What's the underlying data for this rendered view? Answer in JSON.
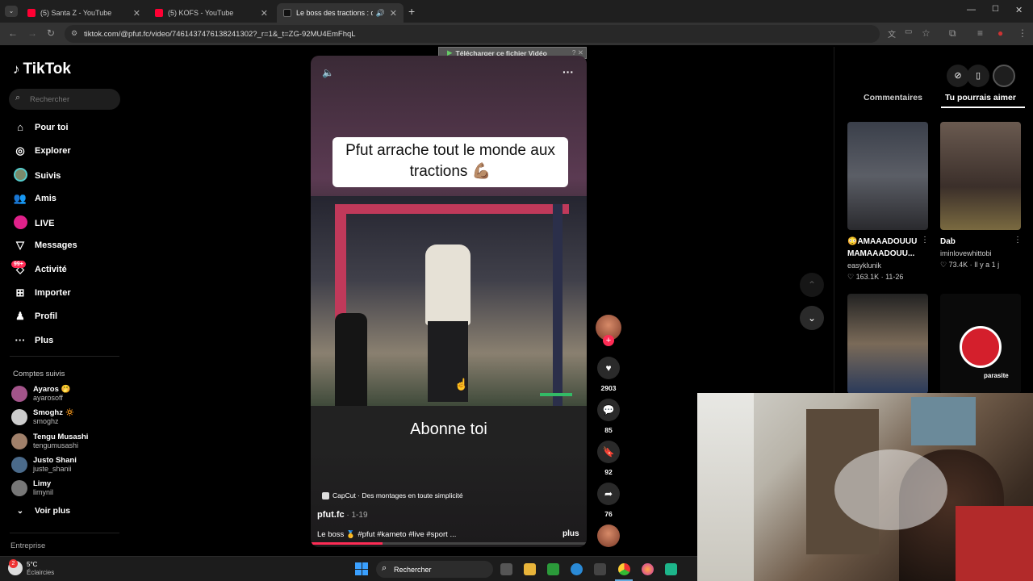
{
  "browser": {
    "tabs": [
      {
        "label": "(5) Santa Z - YouTube",
        "favicon_color": "#ff0033"
      },
      {
        "label": "(5) KOFS - YouTube",
        "favicon_color": "#ff0033"
      },
      {
        "label": "Le boss des tractions : défi",
        "favicon_color": "#111111"
      }
    ],
    "url": "tiktok.com/@pfut.fc/video/7461437476138241302?_r=1&_t=ZG-92MU4EmFhqL",
    "download_bar": "Télécharger ce fichier Vidéo"
  },
  "sidebar": {
    "logo": "TikTok",
    "search_placeholder": "Rechercher",
    "nav": [
      {
        "label": "Pour toi",
        "icon": "home-icon"
      },
      {
        "label": "Explorer",
        "icon": "compass-icon"
      },
      {
        "label": "Suivis",
        "icon": "following-avatar-icon"
      },
      {
        "label": "Amis",
        "icon": "friends-icon"
      },
      {
        "label": "LIVE",
        "icon": "live-icon"
      },
      {
        "label": "Messages",
        "icon": "messages-icon"
      },
      {
        "label": "Activité",
        "icon": "activity-icon",
        "badge": "99+"
      },
      {
        "label": "Importer",
        "icon": "upload-icon"
      },
      {
        "label": "Profil",
        "icon": "profile-icon"
      },
      {
        "label": "Plus",
        "icon": "more-icon"
      }
    ],
    "followed_title": "Comptes suivis",
    "followed": [
      {
        "name": "Ayaros 🤭",
        "handle": "ayarosoff",
        "color": "#a3548a"
      },
      {
        "name": "Smoghz 🔅",
        "handle": "smoghz",
        "color": "#cccccc"
      },
      {
        "name": "Tengu Musashi",
        "handle": "tengumusashi",
        "color": "#a0806a"
      },
      {
        "name": "Justo Shani",
        "handle": "juste_shanii",
        "color": "#4a6a8a"
      },
      {
        "name": "Limy",
        "handle": "limynil",
        "color": "#777777"
      }
    ],
    "see_more": "Voir plus",
    "footer": "Entreprise"
  },
  "video": {
    "caption": "Pfut arrache tout le monde aux tractions 💪🏽",
    "subtitle": "Abonne toi",
    "capcut": "CapCut · Des montages en toute simplicité",
    "author": "pfut.fc",
    "date": "1-19",
    "description": "Le boss 🥇 #pfut #kameto #live #sport ...",
    "more": "plus",
    "progress": 0.26
  },
  "actions": {
    "likes": "2903",
    "comments": "85",
    "saves": "92",
    "shares": "76"
  },
  "right": {
    "tabs": [
      "Commentaires",
      "Tu pourrais aimer"
    ],
    "cards": [
      {
        "title": "😳AMAAADOUUU MAMAAADOUU...",
        "author": "easyklunik",
        "stats": "♡ 163.1K · 11-26"
      },
      {
        "title": "Dab",
        "author": "iminlovewhittobi",
        "stats": "♡ 73.4K · Il y a 1 j"
      }
    ],
    "parasite_label": "parasite"
  },
  "taskbar": {
    "weather_temp": "5°C",
    "weather_desc": "Éclaircies",
    "search": "Rechercher"
  }
}
